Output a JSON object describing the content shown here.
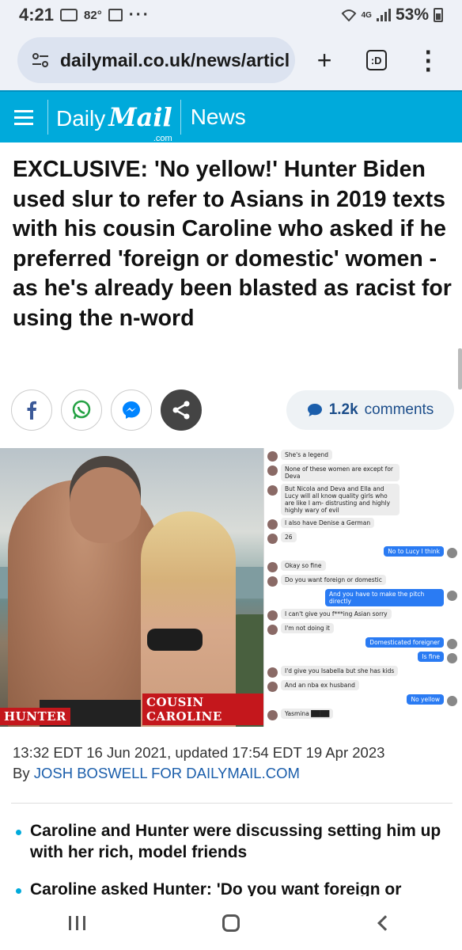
{
  "status_bar": {
    "time": "4:21",
    "temperature": "82°",
    "dots": "···",
    "network": "4G",
    "battery": "53%"
  },
  "browser": {
    "url": "dailymail.co.uk/news/articl",
    "new_tab_glyph": "+",
    "tab_count": ":D",
    "menu_glyph": "⋮"
  },
  "site_header": {
    "logo_daily": "Daily",
    "logo_mail": "Mail",
    "logo_com": ".com",
    "section": "News"
  },
  "article": {
    "headline": "EXCLUSIVE: 'No yellow!' Hunter Biden used slur to refer to Asians in 2019 texts with his cousin Caroline who asked if he preferred 'foreign or domestic' women - as he's already been blasted as racist for using the n-word",
    "comments_count": "1.2k",
    "comments_label": "comments",
    "photo_labels": {
      "left": "HUNTER",
      "right": "COUSIN CAROLINE"
    },
    "chat_messages": [
      {
        "side": "in",
        "text": "She's a legend"
      },
      {
        "side": "in",
        "text": "None of these women are except for Deva"
      },
      {
        "side": "in",
        "text": "But Nicola and Deva and Ella and Lucy will all know quality girls who are like I am- distrusting and highly highly wary of evil"
      },
      {
        "side": "in",
        "text": "I also have Denise a German"
      },
      {
        "side": "in",
        "text": "26"
      },
      {
        "side": "out",
        "text": "No to Lucy I think"
      },
      {
        "side": "in",
        "text": "Okay so fine"
      },
      {
        "side": "in",
        "text": "Do you want foreign or domestic"
      },
      {
        "side": "out",
        "text": "And you have to make the pitch directly"
      },
      {
        "side": "in",
        "text": "I can't give you f***ing Asian sorry"
      },
      {
        "side": "in",
        "text": "I'm not doing it"
      },
      {
        "side": "out",
        "text": "Domesticated foreigner"
      },
      {
        "side": "out",
        "text": "Is fine"
      },
      {
        "side": "in",
        "text": "I'd give you Isabella but she has  kids"
      },
      {
        "side": "in",
        "text": "And an nba ex husband"
      },
      {
        "side": "out",
        "text": "No yellow"
      },
      {
        "side": "in",
        "text": "Yasmina ████"
      }
    ],
    "dateline": "13:32 EDT 16 Jun 2021, updated 17:54 EDT 19 Apr 2023",
    "byline_prefix": "By",
    "byline_author": "JOSH BOSWELL FOR DAILYMAIL.COM",
    "bullets": [
      "Caroline and Hunter were discussing setting him up with her rich, model friends",
      "Caroline asked Hunter: 'Do you want foreign or"
    ]
  },
  "colors": {
    "brand_blue": "#00aadb",
    "link_blue": "#1b5eab",
    "label_red": "#c4171c",
    "imessage_blue": "#2a7bf3"
  },
  "icons": {
    "facebook": "facebook-icon",
    "whatsapp": "whatsapp-icon",
    "messenger": "messenger-icon",
    "share": "share-icon",
    "comment": "comment-bubble-icon"
  }
}
